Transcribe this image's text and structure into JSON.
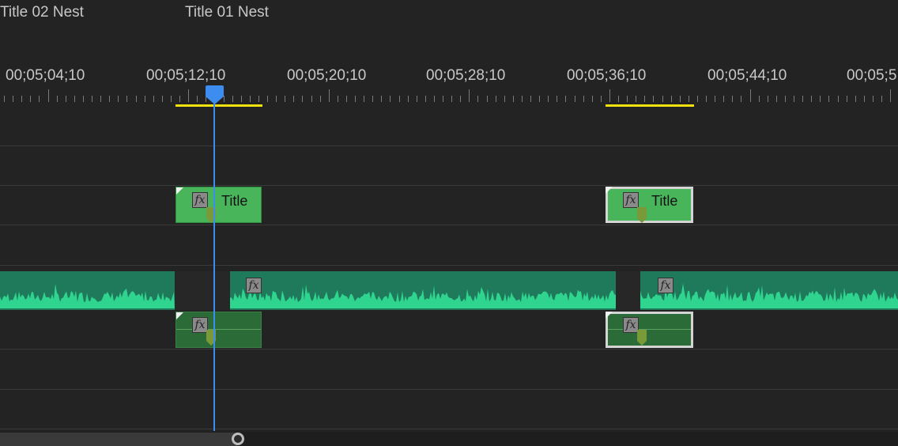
{
  "markers": [
    {
      "label": "Title 02 Nest"
    },
    {
      "label": "Title 01 Nest"
    }
  ],
  "ruler": {
    "timecodes": [
      "00;05;04;10",
      "00;05;12;10",
      "00;05;20;10",
      "00;05;28;10",
      "00;05;36;10",
      "00;05;44;10",
      "00;05;5"
    ]
  },
  "clips": {
    "title_1": {
      "label": "Title",
      "fx": "fx"
    },
    "title_2": {
      "label": "Title",
      "fx": "fx"
    },
    "audio_fx_1": "fx",
    "audio_fx_2": "fx",
    "av_fx_1": "fx",
    "av_fx_2": "fx"
  },
  "colors": {
    "playhead": "#3d8cf0",
    "inout": "#f2e10e",
    "title_clip": "#49b55b",
    "audio_clip": "#1f7a5c",
    "waveform": "#2fd58f"
  }
}
